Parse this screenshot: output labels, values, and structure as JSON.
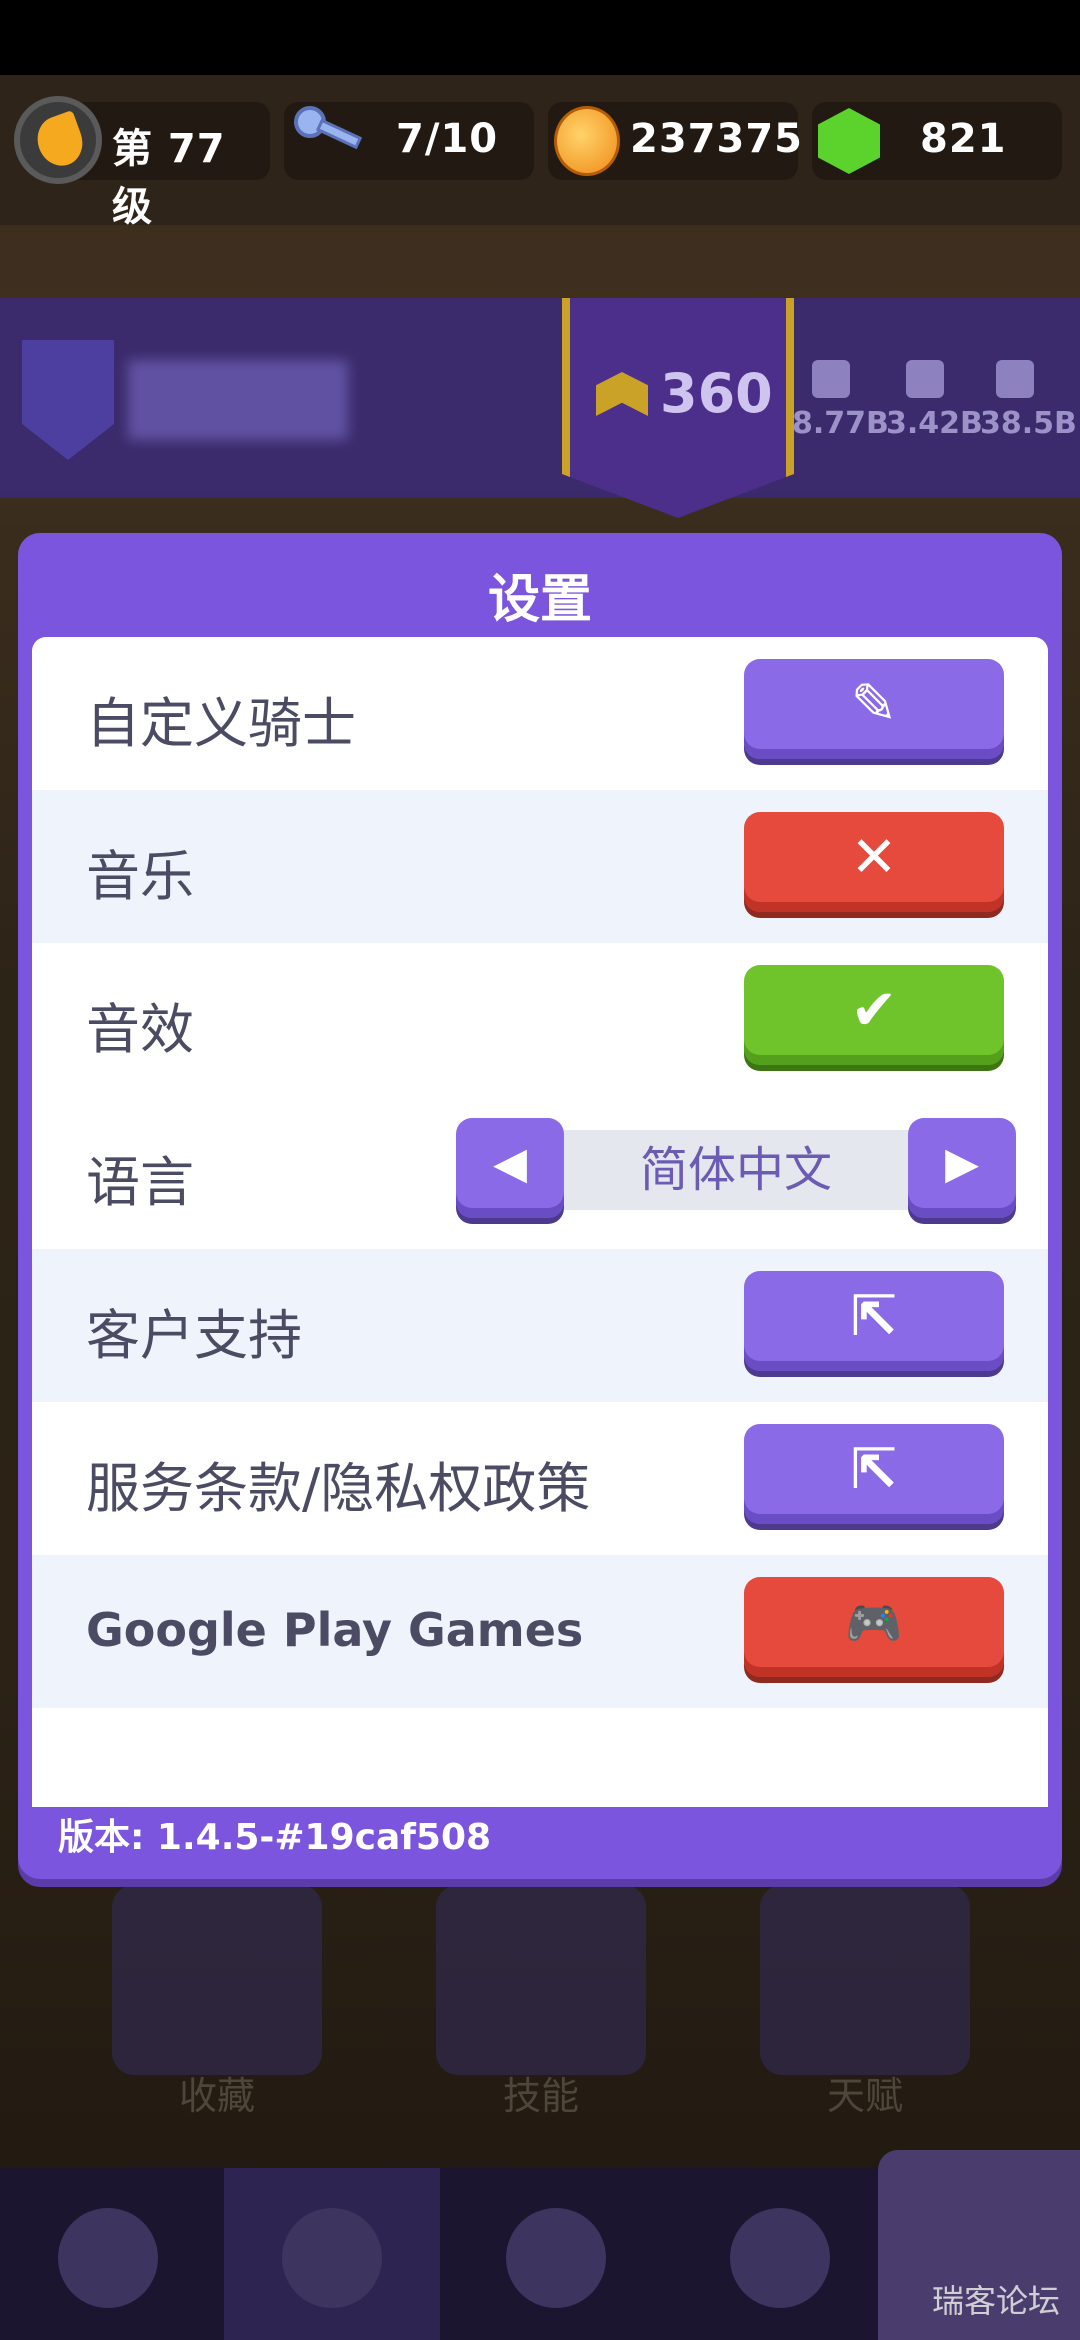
{
  "hud": {
    "level": "第 77 级",
    "keys": "7/10",
    "coins": "237375",
    "gems": "821"
  },
  "player": {
    "rank": "360",
    "stats": [
      "8.77B",
      "3.42B",
      "38.5B"
    ]
  },
  "dialog": {
    "title": "设置",
    "rows": [
      {
        "label": "自定义骑士",
        "button": "edit-icon",
        "glyph": "✎"
      },
      {
        "label": "音乐",
        "button": "close-icon",
        "glyph": "✕"
      },
      {
        "label": "音效",
        "button": "check-icon",
        "glyph": "✔"
      },
      {
        "label": "语言",
        "value": "简体中文"
      },
      {
        "label": "客户支持",
        "button": "external-link-icon",
        "glyph": "⇱"
      },
      {
        "label": "服务条款/隐私权政策",
        "button": "external-link-icon",
        "glyph": "⇱"
      },
      {
        "label": "Google Play Games",
        "button": "gamepad-icon",
        "glyph": "🎮"
      }
    ],
    "version": "版本: 1.4.5-#19caf508"
  },
  "background": {
    "tabs": [
      "收藏",
      "技能",
      "天赋"
    ]
  },
  "watermark": "瑞客论坛"
}
